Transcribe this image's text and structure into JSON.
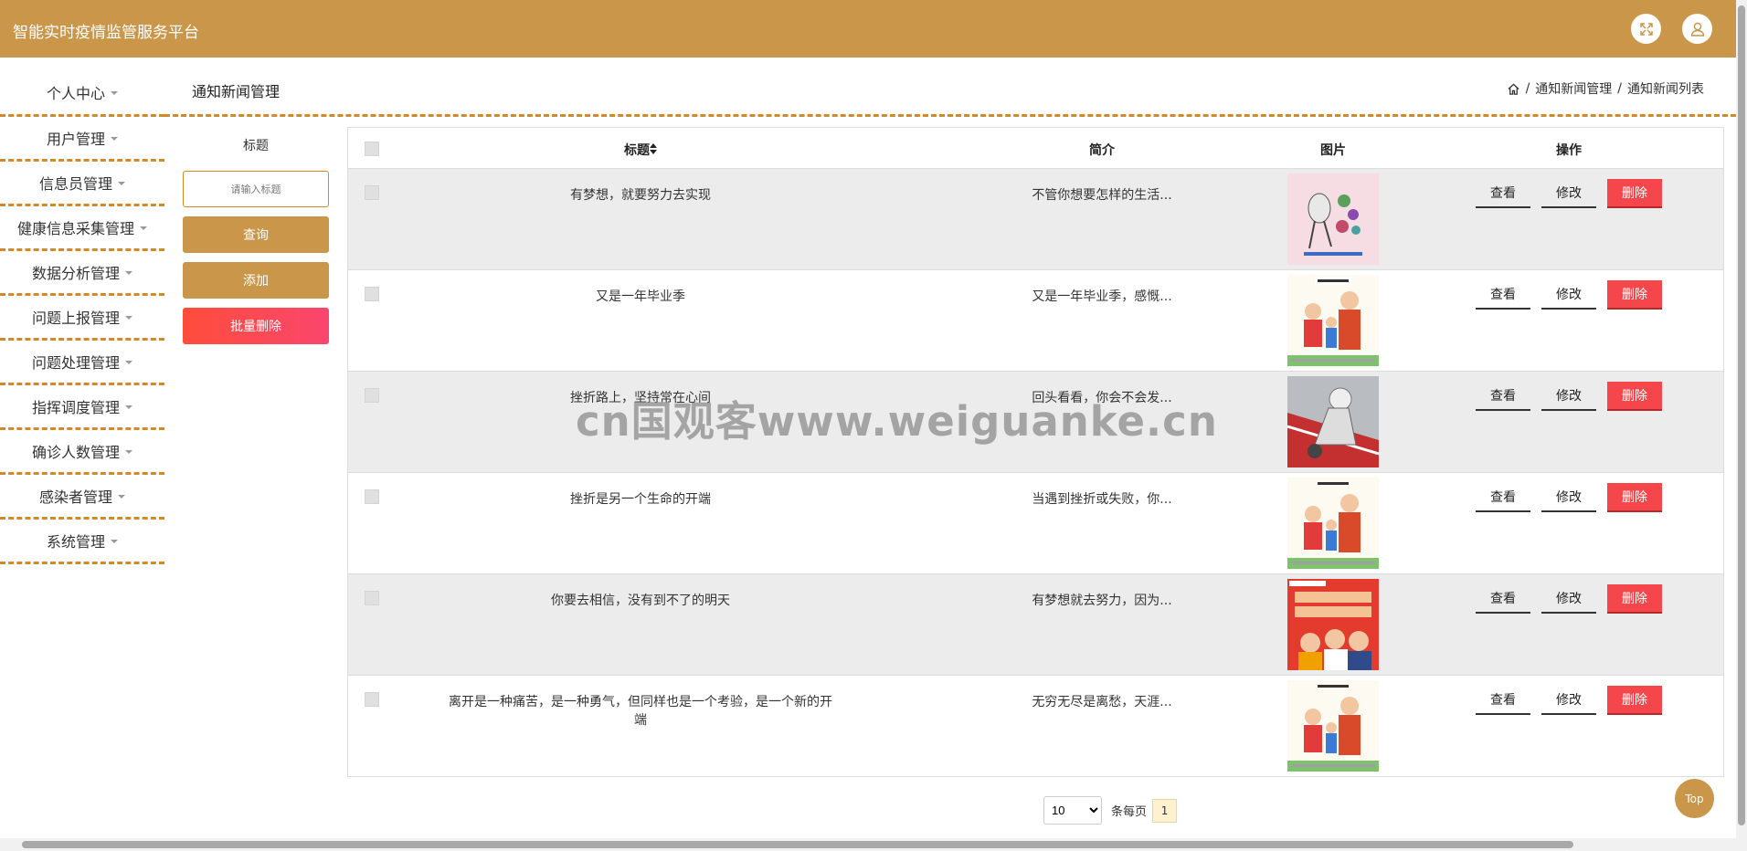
{
  "app": {
    "title": "智能实时疫情监管服务平台"
  },
  "header_icons": [
    "fullscreen-icon",
    "user-icon"
  ],
  "sidebar": {
    "items": [
      {
        "label": "个人中心"
      },
      {
        "label": "用户管理"
      },
      {
        "label": "信息员管理"
      },
      {
        "label": "健康信息采集管理"
      },
      {
        "label": "数据分析管理"
      },
      {
        "label": "问题上报管理"
      },
      {
        "label": "问题处理管理"
      },
      {
        "label": "指挥调度管理"
      },
      {
        "label": "确诊人数管理"
      },
      {
        "label": "感染者管理"
      },
      {
        "label": "系统管理"
      }
    ]
  },
  "page": {
    "title": "通知新闻管理",
    "breadcrumb": [
      "通知新闻管理",
      "通知新闻列表"
    ]
  },
  "search": {
    "label": "标题",
    "placeholder": "请输入标题",
    "query_label": "查询",
    "add_label": "添加",
    "batch_delete_label": "批量删除"
  },
  "table": {
    "headers": {
      "title": "标题",
      "brief": "简介",
      "image": "图片",
      "actions": "操作"
    },
    "actions": {
      "view": "查看",
      "edit": "修改",
      "delete": "删除"
    },
    "rows": [
      {
        "title": "有梦想，就要努力去实现",
        "brief": "不管你想要怎样的生活..."
      },
      {
        "title": "又是一年毕业季",
        "brief": "又是一年毕业季，感慨..."
      },
      {
        "title": "挫折路上，坚持常在心间",
        "brief": "回头看看，你会不会发..."
      },
      {
        "title": "挫折是另一个生命的开端",
        "brief": "当遇到挫折或失败，你..."
      },
      {
        "title": "你要去相信，没有到不了的明天",
        "brief": "有梦想就去努力，因为..."
      },
      {
        "title": "离开是一种痛苦，是一种勇气，但同样也是一个考验，是一个新的开端",
        "brief": "无穷无尽是离愁，天涯..."
      }
    ]
  },
  "pagination": {
    "page_size": "10",
    "per_page_label": "条每页",
    "current_page": "1"
  },
  "top_button": {
    "label": "Top"
  },
  "watermark": "cn国观客www.weiguanke.cn",
  "colors": {
    "primary": "#c9964a",
    "danger": "#f5474b",
    "dashed": "#d2892a"
  }
}
